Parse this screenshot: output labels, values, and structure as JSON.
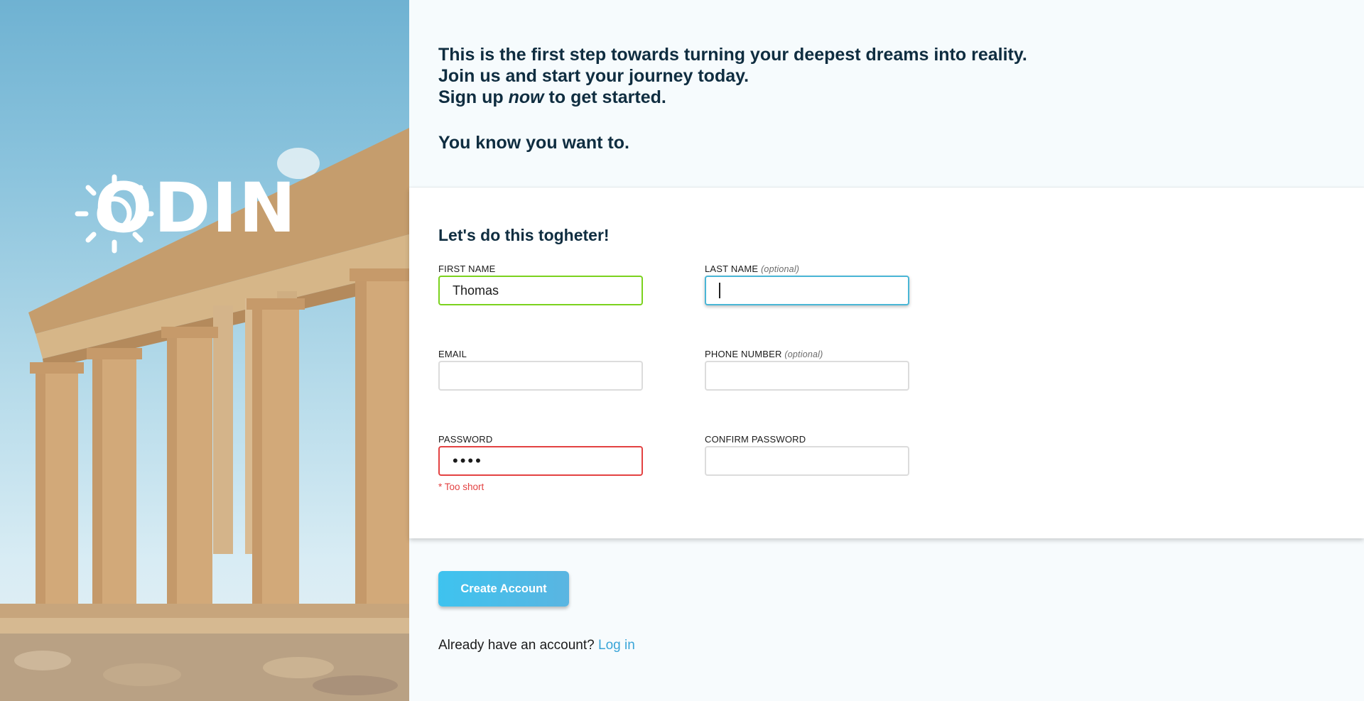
{
  "hero": {
    "logo_text": "ODIN",
    "sun_icon": "sun-icon",
    "colors": {
      "sky_top": "#6fb2d2",
      "stone": "#c9a77c"
    }
  },
  "intro": {
    "line1": "This is the first step towards turning your deepest dreams into reality.",
    "line2": "Join us and start your journey today.",
    "line3_pre": "Sign up ",
    "line3_em": "now",
    "line3_post": " to get started.",
    "line4": "You know you want to."
  },
  "form": {
    "title": "Let's do this togheter!",
    "first_name": {
      "label": "FIRST NAME",
      "value": "Thomas"
    },
    "last_name": {
      "label": "LAST NAME",
      "optional": "(optional)",
      "value": ""
    },
    "email": {
      "label": "EMAIL",
      "value": ""
    },
    "phone": {
      "label": "PHONE NUMBER",
      "optional": "(optional)",
      "value": ""
    },
    "password": {
      "label": "PASSWORD",
      "value": "••••",
      "error": "* Too short"
    },
    "confirm_password": {
      "label": "CONFIRM PASSWORD",
      "value": ""
    }
  },
  "actions": {
    "create_label": "Create Account",
    "login_prompt": "Already have an account?",
    "login_link": "Log in"
  },
  "colors": {
    "valid": "#7bd21e",
    "invalid": "#e34242",
    "focus": "#4ab6d6",
    "accent": "#3ec3ef",
    "link": "#3aa5d8",
    "heading": "#0f2d40"
  }
}
